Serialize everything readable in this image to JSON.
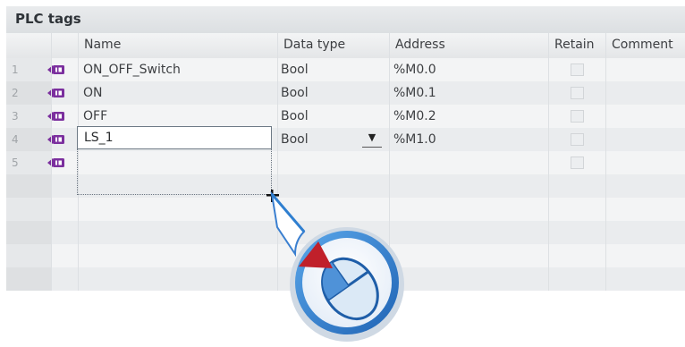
{
  "panel": {
    "title": "PLC tags"
  },
  "columns": {
    "name": "Name",
    "data_type": "Data type",
    "address": "Address",
    "retain": "Retain",
    "comment": "Comment"
  },
  "rows": [
    {
      "index": "1",
      "name": "ON_OFF_Switch",
      "data_type": "Bool",
      "address": "%M0.0"
    },
    {
      "index": "2",
      "name": "ON",
      "data_type": "Bool",
      "address": "%M0.1"
    },
    {
      "index": "3",
      "name": "OFF",
      "data_type": "Bool",
      "address": "%M0.2"
    },
    {
      "index": "4",
      "name": "LS_1",
      "data_type": "Bool",
      "address": "%M1.0"
    },
    {
      "index": "5",
      "name": "",
      "data_type": "",
      "address": ""
    }
  ],
  "icons": {
    "tag": "tag-icon",
    "dropdown": "dropdown-arrow-icon",
    "fill_handle": "crosshair-fill-handle-icon",
    "mouse": "mouse-drag-icon"
  },
  "colors": {
    "tag_icon": "#7b2f9e",
    "callout_ring": "#2f7fd0",
    "arrow": "#c0202a"
  }
}
